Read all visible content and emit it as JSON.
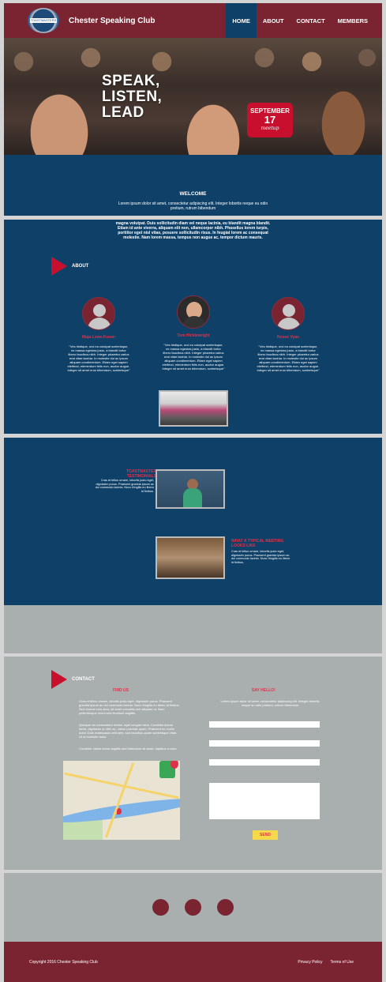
{
  "header": {
    "logo_text": "TOASTMASTERS",
    "title": "Chester Speaking Club",
    "nav": [
      {
        "label": "HOME"
      },
      {
        "label": "ABOUT"
      },
      {
        "label": "CONTACT"
      },
      {
        "label": "MEMBERS"
      }
    ]
  },
  "hero": {
    "lines": [
      "SPEAK,",
      "LISTEN,",
      "LEAD"
    ],
    "badge": {
      "month": "SEPTEMBER",
      "day": "17",
      "sub": "meetup"
    }
  },
  "welcome": {
    "title": "WELCOME",
    "text": "Lorem ipsum dolor sit amet, consectetur adipiscing elit. Integer lobortis neque eu odio pretium, rutrum bibendum"
  },
  "about": {
    "intro": "magna volutpat. Duis sollicitudin diam vel neque lacinia, eu blandit magna blandit. Etiam id ante viverra, aliquam elit non, ullamcorper nibh. Phasellus lorem turpis, porttitor eget nisl vitae, posuere sollicitudin risus. In feugiat lorem ac consequat molestie. Nam lorem massa, tempus non augue ac, tempor dictum mauris.",
    "heading": "ABOUT",
    "members": [
      {
        "name": "Maja Lowe-Fuson",
        "bio": "\"Ves tristique, orci eu volutpat scelerisque, ex massa egestas justo, a blandit tortor libero faucibus nibh. Integer pharetra varius erat vitae lacinia. In molestie dui ac ipsum aliquam condimentum. Etiam eget sapien eleifend, elementum felis non, auctor augue. Integer sit amet eros bibendum, scelerisque\""
      },
      {
        "name": "Tom Hicklewright",
        "bio": "\"Ves tristique, orci eu volutpat scelerisque, ex massa egestas justo, a blandit tortor libero faucibus nibh. Integer pharetra varius erat vitae lacinia. In molestie dui ac ipsum aliquam condimentum. Etiam eget sapien eleifend, elementum felis non, auctor augue. Integer sit amet eros bibendum, scelerisque\""
      },
      {
        "name": "Nosee Vyas",
        "bio": "\"Ves tristique, orci eu volutpat scelerisque, ex massa egestas justo, a blandit tortor libero faucibus nibh. Integer pharetra varius erat vitae lacinia. In molestie dui ac ipsum aliquam condimentum. Etiam eget sapien eleifend, elementum felis non, auctor augue. Integer sit amet eros bibendum, scelerisque\""
      }
    ]
  },
  "testimonials": {
    "t1_title": "TOASTMASTER TESTIMONIALS",
    "t1_text": "Cras et tellus ornare, lobortis justo eget, dignissim purus. Praesent gravida ipsum ac dui commodo lacinia. Nunc fringilla eu libero id finibus.",
    "t2_title": "WHAT A TYPICAL MEETING LOOKS LIKE",
    "t2_text": "Cras et tellus ornare, lobortis justo eget, dignissim purus. Praesent gravida ipsum ac dui commodo lacinia. Nunc fringilla eu libero id finibus."
  },
  "contact": {
    "heading": "CONTACT",
    "find_title": "FIND US",
    "find_p1": "Cras et tellus ornare, lobortis justo eget, dignissim purus. Praesent gravida ipsum ac dui commodo lacinia. Nunc fringilla eu libero id finibus. Sed viverra eros arcu, sit amet convallis orci aliquam ut. Nam pellentesque lorem sed tincidunt sagittis.",
    "find_p2": "Quisque vel consectetur metus, eget congue risus. Curabitur ipsum tortor, dignissim ut nibh ac, varius pulvinar quam. Praesent eu mollis dolor. Duis malesuada velit sem, sed faucibus quam scelerisque vitae. Ut ut molestie dolor.",
    "find_p3": "Curabitur varius lorem sagittis sed bibendum sit amet, dapibus a nulla.",
    "say_title": "SAY HELLO!",
    "say_text": "Lorem ipsum dolor sit amet, consectetur adipiscing elit. Integer lobortis neque eu odio pretium, rutrum bibendum",
    "send_label": "SEND"
  },
  "footer": {
    "copyright": "Copyright 2016  Chester Speaking Club",
    "privacy": "Privacy Policy",
    "terms": "Terms of Use"
  }
}
